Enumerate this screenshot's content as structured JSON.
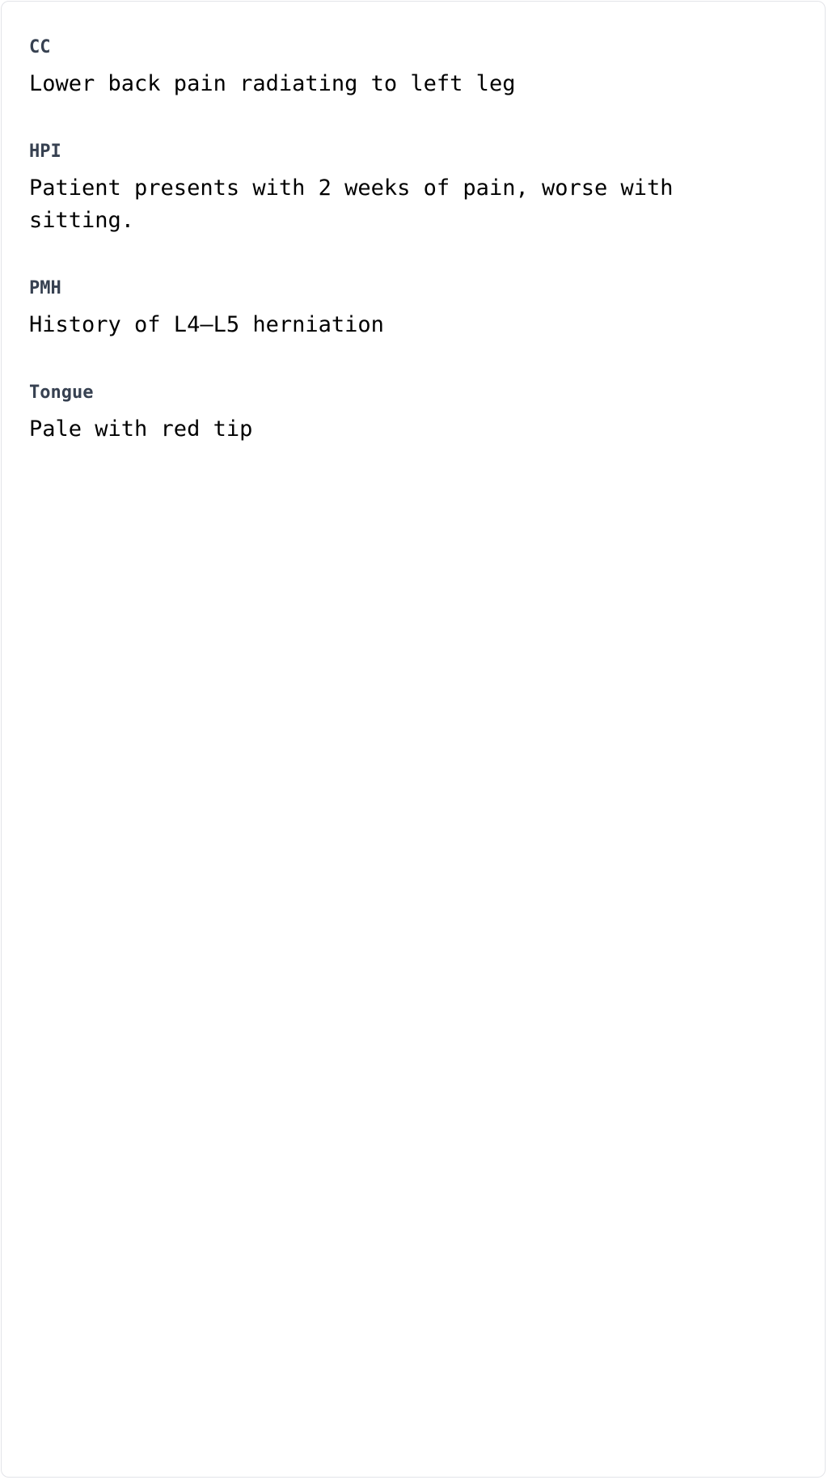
{
  "sections": [
    {
      "label": "CC",
      "value": "Lower back pain radiating to left leg"
    },
    {
      "label": "HPI",
      "value": "Patient presents with 2 weeks of pain, worse with sitting."
    },
    {
      "label": "PMH",
      "value": "History of L4–L5 herniation"
    },
    {
      "label": "Tongue",
      "value": "Pale with red tip"
    }
  ]
}
